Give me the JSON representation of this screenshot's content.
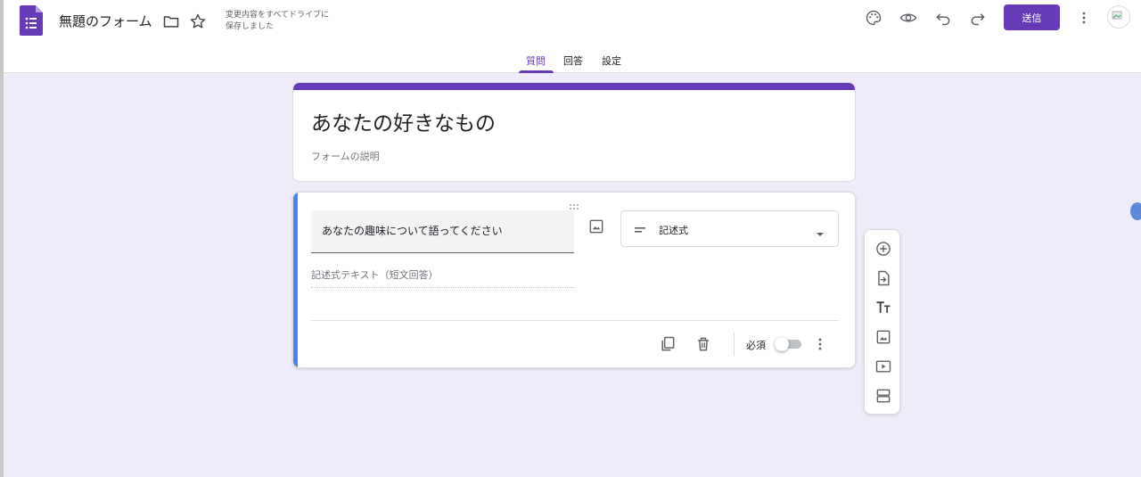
{
  "header": {
    "doc_title": "無題のフォーム",
    "save_status_line1": "変更内容をすべてドライブに",
    "save_status_line2": "保存しました",
    "send_label": "送信",
    "icons": [
      "forms-logo-icon",
      "folder-icon",
      "star-icon",
      "palette-icon",
      "preview-eye-icon",
      "undo-icon",
      "redo-icon",
      "more-vert-icon",
      "avatar"
    ]
  },
  "tabs": [
    {
      "label": "質問",
      "active": true
    },
    {
      "label": "回答",
      "active": false
    },
    {
      "label": "設定",
      "active": false
    }
  ],
  "form": {
    "title": "あなたの好きなもの",
    "description_placeholder": "フォームの説明"
  },
  "question": {
    "text": "あなたの趣味について語ってください",
    "type_label": "記述式",
    "answer_hint": "記述式テキスト（短文回答）",
    "required_label": "必須",
    "required": false
  },
  "side_toolbar": [
    "add-question-icon",
    "import-questions-icon",
    "add-title-icon",
    "add-image-icon",
    "add-video-icon",
    "add-section-icon"
  ],
  "colors": {
    "accent": "#673ab7",
    "background": "#f0ebf8",
    "question_highlight": "#4285f4"
  }
}
